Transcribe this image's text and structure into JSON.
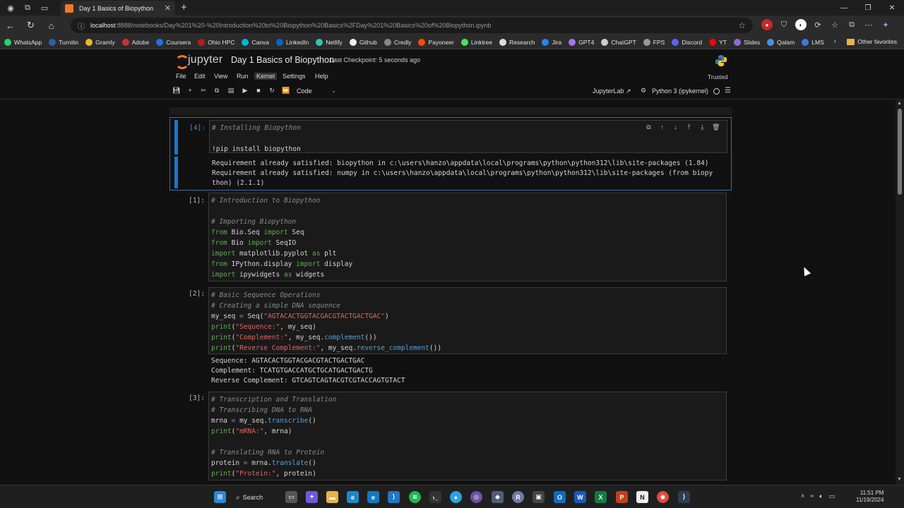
{
  "browser": {
    "tab_title": "Day 1 Basics of Biopython",
    "url_host": "localhost",
    "url_rest": ":8888/notebooks/Day%201%20-%20Introduction%20to%20Biopython%20Basics%2FDay%201%20Basics%20of%20Biopython.ipynb",
    "bookmarks": [
      "WhatsApp",
      "Turnitin",
      "Gramly",
      "Adobe",
      "Coursera",
      "Ohio HPC",
      "Canva",
      "LinkedIn",
      "Netlify",
      "Github",
      "Credly",
      "Payoneer",
      "Linktree",
      "Research",
      "Jira",
      "GPT4",
      "ChatGPT",
      "FPS",
      "Discord",
      "YT",
      "Slides",
      "Qalam",
      "LMS"
    ],
    "other_favorites": "Other favorites"
  },
  "jupyter": {
    "logo_text": "jupyter",
    "notebook_title": "Day 1 Basics of Biopython",
    "checkpoint": "Last Checkpoint: 5 seconds ago",
    "menu": [
      "File",
      "Edit",
      "View",
      "Run",
      "Kernel",
      "Settings",
      "Help"
    ],
    "trusted": "Trusted",
    "cell_type": "Code",
    "jupyterlab_link": "JupyterLab",
    "kernel_name": "Python 3 (ipykernel)"
  },
  "cells": {
    "c1": {
      "prompt": "[4]:",
      "code_comment": "# Installing Biopython",
      "code_cmd": "!pip install biopython",
      "output": "Requirement already satisfied: biopython in c:\\users\\hanzo\\appdata\\local\\programs\\python\\python312\\lib\\site-packages (1.84)\nRequirement already satisfied: numpy in c:\\users\\hanzo\\appdata\\local\\programs\\python\\python312\\lib\\site-packages (from biopy\nthon) (2.1.1)"
    },
    "c2": {
      "prompt": "[1]:",
      "l1": "# Introduction to Biopython",
      "l3": "# Importing Biopython",
      "l4a": "from",
      "l4b": " Bio.Seq ",
      "l4c": "import",
      "l4d": " Seq",
      "l5a": "from",
      "l5b": " Bio ",
      "l5c": "import",
      "l5d": " SeqIO",
      "l6a": "import",
      "l6b": " matplotlib.pyplot ",
      "l6c": "as",
      "l6d": " plt",
      "l7a": "from",
      "l7b": " IPython.display ",
      "l7c": "import",
      "l7d": " display",
      "l8a": "import",
      "l8b": " ipywidgets ",
      "l8c": "as",
      "l8d": " widgets"
    },
    "c3": {
      "prompt": "[2]:",
      "l1": "# Basic Sequence Operations",
      "l2": "# Creating a simple DNA sequence",
      "l3a": "my_seq ",
      "l3b": "=",
      "l3c": " Seq(",
      "l3d": "\"AGTACACTGGTACGACGTACTGACTGAC\"",
      "l3e": ")",
      "l4a": "print",
      "l4b": "(",
      "l4c": "\"Sequence:\"",
      "l4d": ", my_seq)",
      "l5a": "print",
      "l5b": "(",
      "l5c": "\"Complement:\"",
      "l5d": ", my_seq.",
      "l5e": "complement",
      "l5f": "())",
      "l6a": "print",
      "l6b": "(",
      "l6c": "\"Reverse Complement:\"",
      "l6d": ", my_seq.",
      "l6e": "reverse_complement",
      "l6f": "())",
      "output": "Sequence: AGTACACTGGTACGACGTACTGACTGAC\nComplement: TCATGTGACCATGCTGCATGACTGACTG\nReverse Complement: GTCAGTCAGTACGTCGTACCAGTGTACT"
    },
    "c4": {
      "prompt": "[3]:",
      "l1": "# Transcription and Translation",
      "l2": "# Transcribing DNA to RNA",
      "l3a": "mrna ",
      "l3b": "=",
      "l3c": " my_seq.",
      "l3d": "transcribe",
      "l3e": "()",
      "l4a": "print",
      "l4b": "(",
      "l4c": "\"mRNA:\"",
      "l4d": ", mrna)",
      "l6": "# Translating RNA to Protein",
      "l7a": "protein ",
      "l7b": "=",
      "l7c": " mrna.",
      "l7d": "translate",
      "l7e": "()",
      "l8a": "print",
      "l8b": "(",
      "l8c": "\"Protein:\"",
      "l8d": ", protein)"
    }
  },
  "taskbar": {
    "search_label": "Search",
    "time": "11:51 PM",
    "date": "11/19/2024"
  },
  "colors": {
    "accent_blue": "#1976d2",
    "jupyter_orange": "#f37726"
  }
}
